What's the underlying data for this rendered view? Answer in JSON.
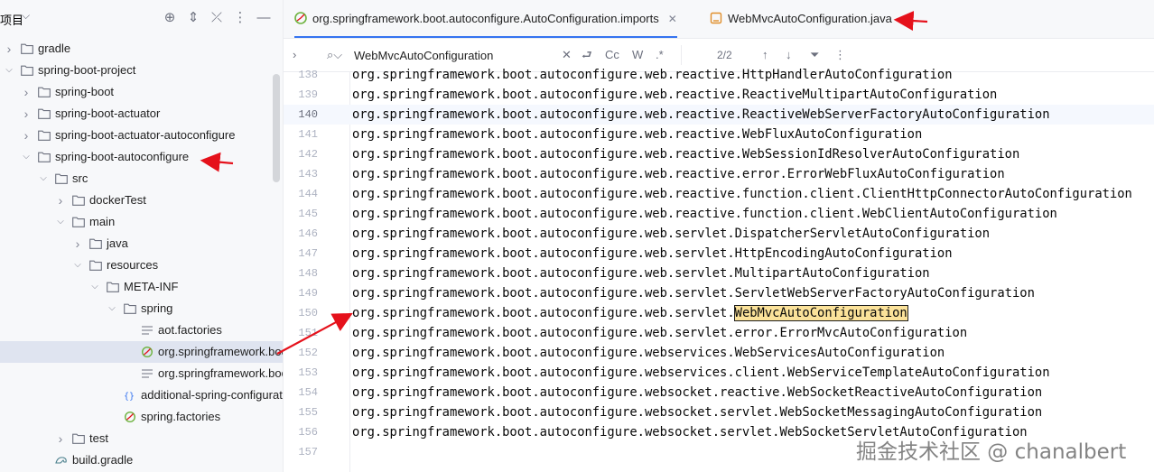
{
  "project_panel": {
    "title": "项目",
    "tree": [
      {
        "label": "gradle",
        "level": 0,
        "expanded": false,
        "kind": "folder"
      },
      {
        "label": "spring-boot-project",
        "level": 0,
        "expanded": true,
        "kind": "folder"
      },
      {
        "label": "spring-boot",
        "level": 1,
        "expanded": false,
        "kind": "folder"
      },
      {
        "label": "spring-boot-actuator",
        "level": 1,
        "expanded": false,
        "kind": "folder"
      },
      {
        "label": "spring-boot-actuator-autoconfigure",
        "level": 1,
        "expanded": false,
        "kind": "folder"
      },
      {
        "label": "spring-boot-autoconfigure",
        "level": 1,
        "expanded": true,
        "kind": "folder"
      },
      {
        "label": "src",
        "level": 2,
        "expanded": true,
        "kind": "folder"
      },
      {
        "label": "dockerTest",
        "level": 3,
        "expanded": false,
        "kind": "folder"
      },
      {
        "label": "main",
        "level": 3,
        "expanded": true,
        "kind": "folder"
      },
      {
        "label": "java",
        "level": 4,
        "expanded": false,
        "kind": "folder"
      },
      {
        "label": "resources",
        "level": 4,
        "expanded": true,
        "kind": "folder"
      },
      {
        "label": "META-INF",
        "level": 5,
        "expanded": true,
        "kind": "folder"
      },
      {
        "label": "spring",
        "level": 6,
        "expanded": true,
        "kind": "folder"
      },
      {
        "label": "aot.factories",
        "level": 7,
        "kind": "file-lines"
      },
      {
        "label": "org.springframework.boot.autoconfigure.AutoConfiguration.imports",
        "level": 7,
        "kind": "file-spring",
        "selected": true
      },
      {
        "label": "org.springframework.boot.autoconfigure.AutoConfiguration.replacements",
        "level": 7,
        "kind": "file-lines"
      },
      {
        "label": "additional-spring-configuration-metadata.json",
        "level": 6,
        "kind": "file-json"
      },
      {
        "label": "spring.factories",
        "level": 6,
        "kind": "file-spring"
      },
      {
        "label": "test",
        "level": 3,
        "expanded": false,
        "kind": "folder"
      },
      {
        "label": "build.gradle",
        "level": 2,
        "kind": "file-gradle"
      }
    ]
  },
  "tabs": [
    {
      "label": "org.springframework.boot.autoconfigure.AutoConfiguration.imports",
      "close": "✕",
      "active": true,
      "icon": "spring-file-icon"
    },
    {
      "label": "WebMvcAutoConfiguration.java",
      "active": false,
      "icon": "java-class-icon"
    }
  ],
  "find": {
    "query": "WebMvcAutoConfiguration",
    "match_case": "Cc",
    "words": "W",
    "regex": ".*",
    "count": "2/2"
  },
  "editor": {
    "first_line": 138,
    "current_line": 140,
    "lines": [
      "org.springframework.boot.autoconfigure.web.reactive.HttpHandlerAutoConfiguration",
      "org.springframework.boot.autoconfigure.web.reactive.ReactiveMultipartAutoConfiguration",
      "org.springframework.boot.autoconfigure.web.reactive.ReactiveWebServerFactoryAutoConfiguration",
      "org.springframework.boot.autoconfigure.web.reactive.WebFluxAutoConfiguration",
      "org.springframework.boot.autoconfigure.web.reactive.WebSessionIdResolverAutoConfiguration",
      "org.springframework.boot.autoconfigure.web.reactive.error.ErrorWebFluxAutoConfiguration",
      "org.springframework.boot.autoconfigure.web.reactive.function.client.ClientHttpConnectorAutoConfiguration",
      "org.springframework.boot.autoconfigure.web.reactive.function.client.WebClientAutoConfiguration",
      "org.springframework.boot.autoconfigure.web.servlet.DispatcherServletAutoConfiguration",
      "org.springframework.boot.autoconfigure.web.servlet.HttpEncodingAutoConfiguration",
      "org.springframework.boot.autoconfigure.web.servlet.MultipartAutoConfiguration",
      "org.springframework.boot.autoconfigure.web.servlet.ServletWebServerFactoryAutoConfiguration",
      "org.springframework.boot.autoconfigure.web.servlet.WebMvcAutoConfiguration",
      "org.springframework.boot.autoconfigure.web.servlet.error.ErrorMvcAutoConfiguration",
      "org.springframework.boot.autoconfigure.webservices.WebServicesAutoConfiguration",
      "org.springframework.boot.autoconfigure.webservices.client.WebServiceTemplateAutoConfiguration",
      "org.springframework.boot.autoconfigure.websocket.reactive.WebSocketReactiveAutoConfiguration",
      "org.springframework.boot.autoconfigure.websocket.servlet.WebSocketMessagingAutoConfiguration",
      "org.springframework.boot.autoconfigure.websocket.servlet.WebSocketServletAutoConfiguration",
      ""
    ],
    "highlight": {
      "line": 150,
      "text": "WebMvcAutoConfiguration"
    }
  },
  "watermark": "掘金技术社区 @ chanalbert",
  "colors": {
    "accent": "#3574f0",
    "annotation_arrow": "#e5111b",
    "search_highlight": "#fbe29a"
  }
}
